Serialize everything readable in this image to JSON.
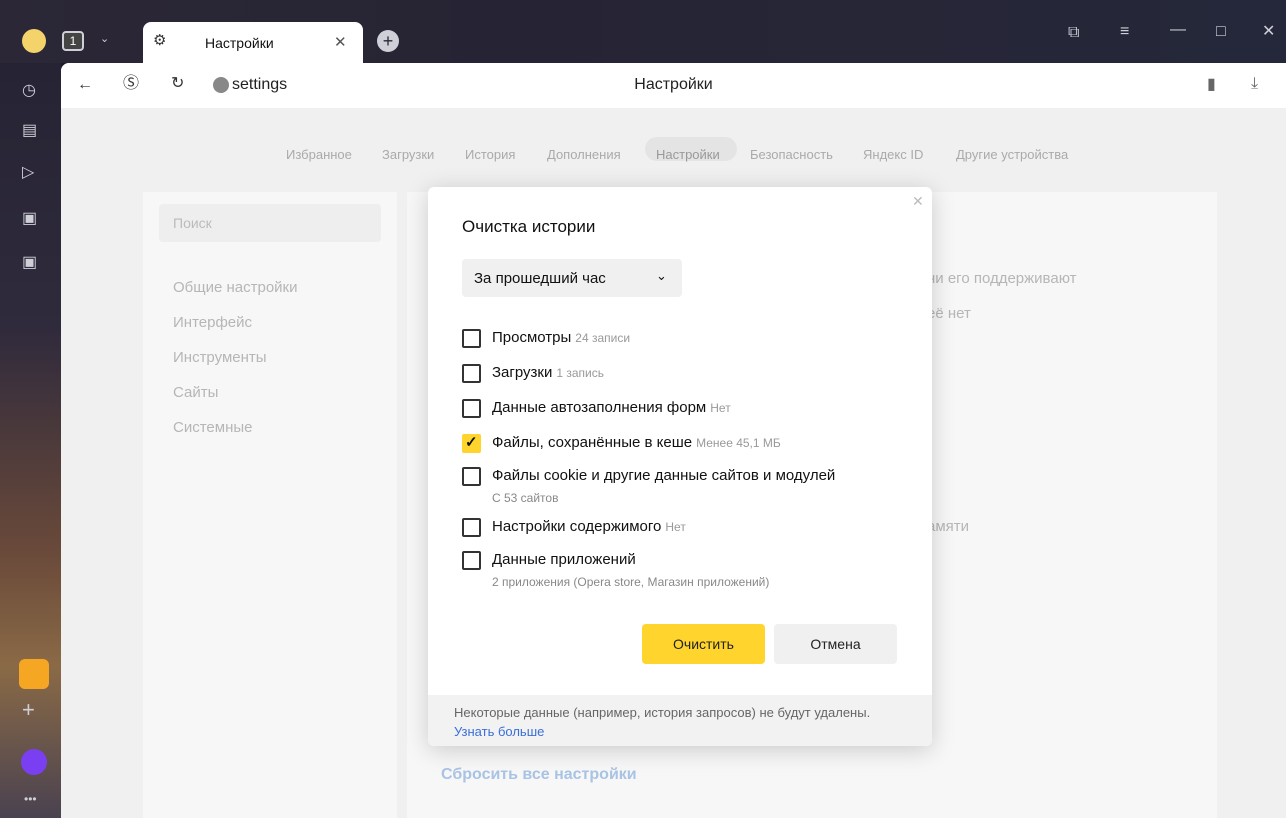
{
  "window": {
    "tab_count": "1",
    "tab_title": "Настройки"
  },
  "address": {
    "url": "settings",
    "page_title": "Настройки"
  },
  "nav": {
    "items": [
      "Избранное",
      "Загрузки",
      "История",
      "Дополнения",
      "Настройки",
      "Безопасность",
      "Яндекс ID",
      "Другие устройства"
    ],
    "active": "Настройки"
  },
  "sidebar": {
    "search_placeholder": "Поиск",
    "items": [
      "Общие настройки",
      "Интерфейс",
      "Инструменты",
      "Сайты",
      "Системные"
    ]
  },
  "right_panel": {
    "fragment1": "ни его поддерживают",
    "fragment2": "её нет",
    "fragment3": "амяти",
    "reset": "Сбросить все настройки"
  },
  "dialog": {
    "title": "Очистка истории",
    "period": "За прошедший час",
    "options": [
      {
        "label": "Просмотры",
        "note": "24 записи",
        "checked": false
      },
      {
        "label": "Загрузки",
        "note": "1 запись",
        "checked": false
      },
      {
        "label": "Данные автозаполнения форм",
        "note": "Нет",
        "checked": false
      },
      {
        "label": "Файлы, сохранённые в кеше",
        "note": "Менее 45,1 МБ",
        "checked": true
      },
      {
        "label": "Файлы cookie и другие данные сайтов и модулей",
        "sub": "С 53 сайтов",
        "checked": false
      },
      {
        "label": "Настройки содержимого",
        "note": "Нет",
        "checked": false
      },
      {
        "label": "Данные приложений",
        "sub": "2 приложения (Opera store, Магазин приложений)",
        "checked": false
      }
    ],
    "clear_label": "Очистить",
    "cancel_label": "Отмена",
    "footer_text": "Некоторые данные (например, история запросов) не будут удалены.",
    "footer_link": "Узнать больше"
  },
  "icons": {
    "accent": "#ffd42c",
    "link": "#3a6fd8"
  }
}
